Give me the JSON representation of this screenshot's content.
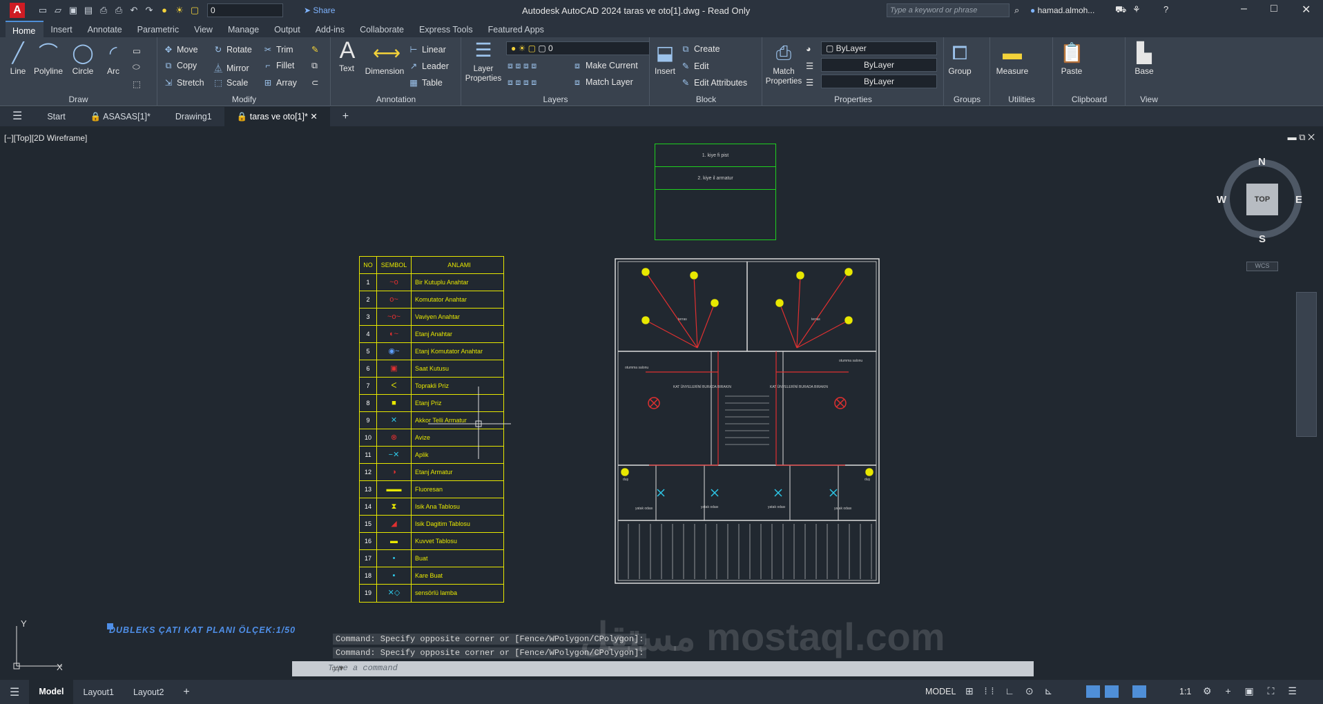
{
  "titlebar": {
    "title": "Autodesk AutoCAD 2024    taras ve oto[1].dwg - Read Only",
    "layer_value": "0",
    "share_label": "Share",
    "search_placeholder": "Type a keyword or phrase",
    "user": "hamad.almoh..."
  },
  "ribbon_tabs": [
    "Home",
    "Insert",
    "Annotate",
    "Parametric",
    "View",
    "Manage",
    "Output",
    "Add-ins",
    "Collaborate",
    "Express Tools",
    "Featured Apps"
  ],
  "ribbon": {
    "draw": {
      "title": "Draw",
      "line": "Line",
      "polyline": "Polyline",
      "circle": "Circle",
      "arc": "Arc"
    },
    "modify": {
      "title": "Modify",
      "move": "Move",
      "rotate": "Rotate",
      "trim": "Trim",
      "copy": "Copy",
      "mirror": "Mirror",
      "fillet": "Fillet",
      "stretch": "Stretch",
      "scale": "Scale",
      "array": "Array"
    },
    "annotation": {
      "title": "Annotation",
      "text": "Text",
      "dimension": "Dimension",
      "linear": "Linear",
      "leader": "Leader",
      "table": "Table"
    },
    "layers": {
      "title": "Layers",
      "layer_properties": "Layer Properties",
      "layer_value": "0",
      "make_current": "Make Current",
      "match_layer": "Match Layer"
    },
    "block": {
      "title": "Block",
      "insert": "Insert",
      "create": "Create",
      "edit": "Edit",
      "edit_attributes": "Edit Attributes"
    },
    "properties": {
      "title": "Properties",
      "match_properties": "Match Properties",
      "bylayer1": "ByLayer",
      "bylayer2": "ByLayer",
      "bylayer3": "ByLayer"
    },
    "groups": {
      "title": "Groups",
      "group": "Group"
    },
    "utilities": {
      "title": "Utilities",
      "measure": "Measure"
    },
    "clipboard": {
      "title": "Clipboard",
      "paste": "Paste"
    },
    "view": {
      "title": "View",
      "base": "Base"
    }
  },
  "doc_tabs": [
    "Start",
    "ASASAS[1]*",
    "Drawing1",
    "taras ve oto[1]*"
  ],
  "viewport_label": "[−][Top][2D Wireframe]",
  "notes": [
    "1. kiye fi pist",
    "2. kiye il armatur"
  ],
  "legend": {
    "headers": [
      "NO",
      "SEMBOL",
      "ANLAMI"
    ],
    "rows": [
      {
        "no": "1",
        "desc": "Bir Kutuplu Anahtar",
        "sym": "~o",
        "color": "#e03030"
      },
      {
        "no": "2",
        "desc": "Komutator Anahtar",
        "sym": "o~",
        "color": "#e03030"
      },
      {
        "no": "3",
        "desc": "Vaviyen Anahtar",
        "sym": "~o~",
        "color": "#e03030"
      },
      {
        "no": "4",
        "desc": "Etanj Anahtar",
        "sym": "◐~",
        "color": "#e03030"
      },
      {
        "no": "5",
        "desc": " Etanj  Komutator Anahtar",
        "sym": "◉~",
        "color": "#5fa0ff"
      },
      {
        "no": "6",
        "desc": "Saat Kutusu",
        "sym": "▣",
        "color": "#e03030"
      },
      {
        "no": "7",
        "desc": "Toprakli Priz",
        "sym": "ᐸ",
        "color": "#e8e800"
      },
      {
        "no": "8",
        "desc": "Etanj Priz",
        "sym": "■",
        "color": "#e8e800"
      },
      {
        "no": "9",
        "desc": "Akkor Telli Armatur",
        "sym": "✕",
        "color": "#2ec8e8"
      },
      {
        "no": "10",
        "desc": "Avize",
        "sym": "⊗",
        "color": "#e03030"
      },
      {
        "no": "11",
        "desc": "Aplik",
        "sym": "−✕",
        "color": "#2ec8e8"
      },
      {
        "no": "12",
        "desc": "Etanj Armatur",
        "sym": "◑",
        "color": "#e03030"
      },
      {
        "no": "13",
        "desc": "Fluoresan",
        "sym": "▬▬",
        "color": "#e8e800"
      },
      {
        "no": "14",
        "desc": "Isik Ana Tablosu",
        "sym": "⧗",
        "color": "#e8e800"
      },
      {
        "no": "15",
        "desc": "Isik Dagitim Tablosu",
        "sym": "◢",
        "color": "#e03030"
      },
      {
        "no": "16",
        "desc": "Kuvvet Tablosu",
        "sym": "▬",
        "color": "#e8e800"
      },
      {
        "no": "17",
        "desc": "Buat",
        "sym": "•",
        "color": "#2ec8e8"
      },
      {
        "no": "18",
        "desc": "Kare Buat",
        "sym": "▪",
        "color": "#2ec8e8"
      },
      {
        "no": "19",
        "desc": "sensörlü lamba",
        "sym": "✕◇",
        "color": "#2ec8e8"
      }
    ]
  },
  "plan": {
    "room_labels": [
      "terras",
      "terras",
      "otumma salonu",
      "otumma salonu",
      "KAT ÜNYELERİNİ BURADA BIRAKIN",
      "KAT ÜNYELERİNİ BURADA BIRAKIN",
      "yatak odası",
      "yatak odası",
      "yatak odası",
      "yatak odası",
      "duş",
      "duş"
    ]
  },
  "plan_title": "DUBLEKS ÇATI KAT PLANI ÖLÇEK:1/50",
  "navcube": {
    "top": "TOP",
    "n": "N",
    "s": "S",
    "e": "E",
    "w": "W",
    "wcs": "WCS"
  },
  "command": {
    "history1": "Command: Specify opposite corner or [Fence/WPolygon/CPolygon]:",
    "history2": "Command: Specify opposite corner or [Fence/WPolygon/CPolygon]:",
    "placeholder": "Type a command"
  },
  "status": {
    "model_tab": "Model",
    "layout1": "Layout1",
    "layout2": "Layout2",
    "model_label": "MODEL",
    "scale": "1:1"
  },
  "watermark": "مستقل mostaql.com"
}
